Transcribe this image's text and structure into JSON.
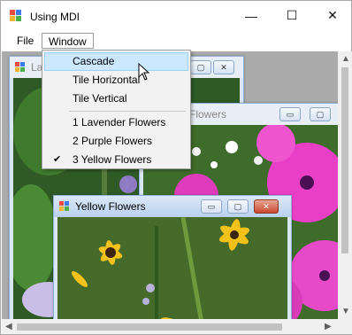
{
  "app": {
    "title": "Using MDI"
  },
  "window_controls": {
    "minimize": "—",
    "maximize": "☐",
    "close": "✕"
  },
  "menubar": {
    "file_label": "File",
    "window_label": "Window"
  },
  "window_menu": {
    "items": [
      {
        "label": "Cascade"
      },
      {
        "label": "Tile Horizontal"
      },
      {
        "label": "Tile Vertical"
      },
      {
        "label": "1 Lavender Flowers"
      },
      {
        "label": "2 Purple Flowers"
      },
      {
        "label": "3 Yellow Flowers",
        "checked": true
      }
    ],
    "hovered": "Cascade",
    "check_mark": "✔"
  },
  "children": {
    "lavender": {
      "title_fragment": "La"
    },
    "purple": {
      "title_fragment": "Flowers"
    },
    "yellow": {
      "title": "Yellow Flowers"
    }
  },
  "scroll": {
    "up": "▲",
    "down": "▼",
    "left": "◀",
    "right": "▶"
  },
  "colors": {
    "mdi_background": "#ababab",
    "menu_hover": "#cce8ff",
    "close_red": "#c7482c"
  }
}
